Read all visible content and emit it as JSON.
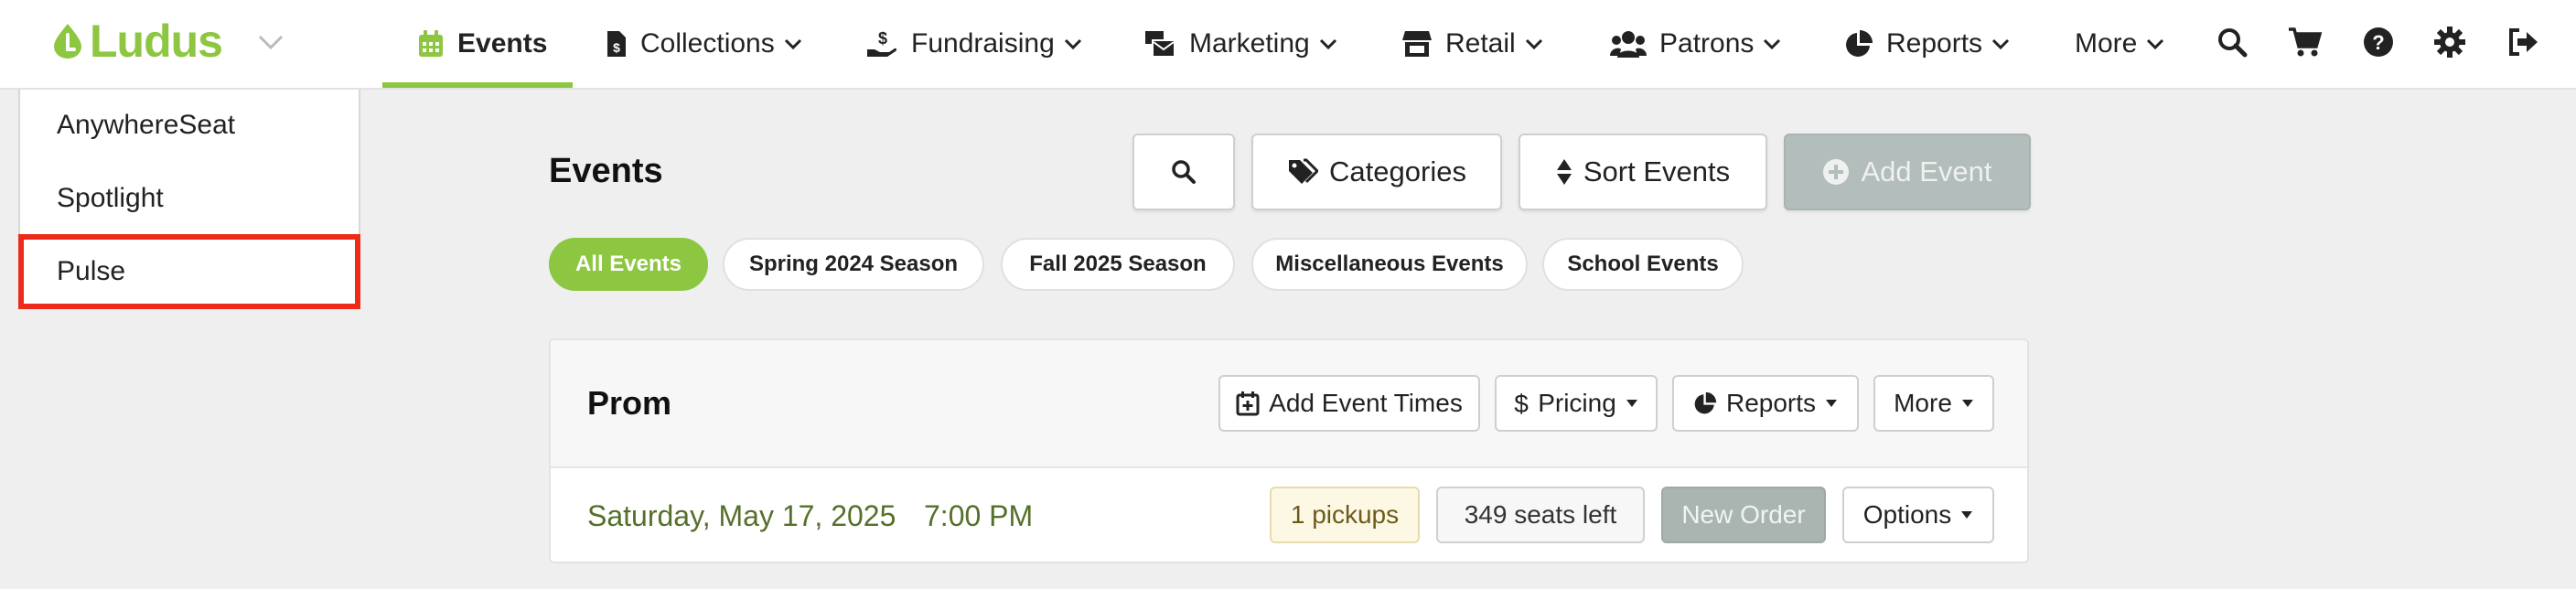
{
  "app": {
    "logo_text": "Ludus",
    "brand_color": "#8dc641"
  },
  "nav": {
    "items": [
      {
        "label": "Events",
        "icon": "calendar-icon",
        "active": true
      },
      {
        "label": "Collections",
        "icon": "document-dollar-icon"
      },
      {
        "label": "Fundraising",
        "icon": "hand-dollar-icon"
      },
      {
        "label": "Marketing",
        "icon": "mail-bulk-icon"
      },
      {
        "label": "Retail",
        "icon": "store-icon"
      },
      {
        "label": "Patrons",
        "icon": "users-icon"
      },
      {
        "label": "Reports",
        "icon": "pie-chart-icon"
      },
      {
        "label": "More"
      }
    ],
    "icons": [
      "search-icon",
      "cart-icon",
      "help-icon",
      "gear-icon",
      "sign-out-icon"
    ]
  },
  "dropdown": {
    "items": [
      "AnywhereSeat",
      "Spotlight",
      "Pulse"
    ],
    "highlighted": "Pulse",
    "highlight_color": "#ee2a1b"
  },
  "main": {
    "title": "Events",
    "toolbar": {
      "categories_label": "Categories",
      "sort_label": "Sort Events",
      "add_label": "Add Event"
    },
    "filters": [
      "All Events",
      "Spring 2024 Season",
      "Fall 2025 Season",
      "Miscellaneous Events",
      "School Events"
    ]
  },
  "event": {
    "title": "Prom",
    "actions": {
      "add_times": "Add Event Times",
      "pricing": "Pricing",
      "reports": "Reports",
      "more": "More"
    },
    "row": {
      "date": "Saturday, May 17, 2025",
      "time": "7:00 PM",
      "pickups": "1 pickups",
      "seats_left": "349 seats left",
      "new_order": "New Order",
      "options": "Options"
    }
  }
}
